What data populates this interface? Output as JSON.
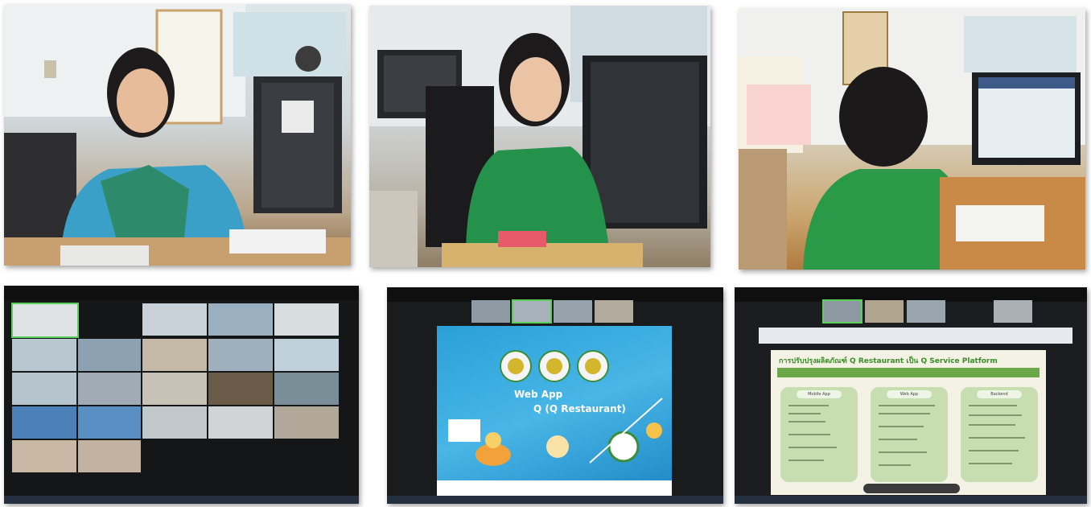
{
  "photos": [
    {
      "name": "office-photo-1"
    },
    {
      "name": "office-photo-2"
    },
    {
      "name": "office-photo-3"
    }
  ],
  "screen_2_slide": {
    "web_app": "Web App",
    "title": "Q (Q Restaurant)"
  },
  "screen_3_slide": {
    "title": "การปรับปรุงผลิตภัณฑ์ Q Restaurant เป็น Q Service Platform",
    "columns": [
      "Mobile App",
      "Web App",
      "Backend"
    ]
  },
  "colors": {
    "zoom_active_border": "#5ad05a",
    "slide_blue": "#2aa0d8",
    "slide_green": "#3a8e2a"
  }
}
